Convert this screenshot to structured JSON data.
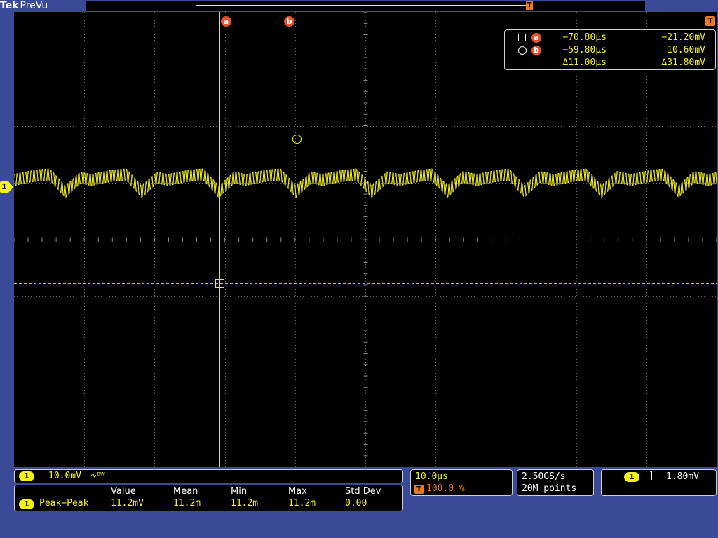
{
  "header": {
    "brand": "Tek",
    "mode": "PreVu",
    "trigger_marker": "T"
  },
  "cursors": {
    "a_label": "a",
    "b_label": "b",
    "trigger_label": "T",
    "a_time": "−70.80µs",
    "a_value": "−21.20mV",
    "b_time": "−59.80µs",
    "b_value": "10.60mV",
    "delta_time": "Δ11.00µs",
    "delta_value": "Δ31.80mV"
  },
  "channel": {
    "number": "1",
    "scale": "10.0mV",
    "bw_symbol": "∿ᴮᵂ"
  },
  "measurement": {
    "headers": {
      "value": "Value",
      "mean": "Mean",
      "min": "Min",
      "max": "Max",
      "std": "Std Dev"
    },
    "channel": "1",
    "name": "Peak−Peak",
    "value": "11.2mV",
    "mean": "11.2m",
    "min": "11.2m",
    "max": "11.2m",
    "std": "0.00"
  },
  "timebase": {
    "scale": "10.0µs",
    "trigger_icon": "T",
    "position": "100.0 %"
  },
  "acquisition": {
    "rate": "2.50GS/s",
    "points": "20M points"
  },
  "trigger": {
    "channel": "1",
    "slope_icon": "falling-edge-icon",
    "slope_glyph": "⌉",
    "level": "1.80mV"
  },
  "colors": {
    "background": "#3a4a96",
    "trace": "#f3f01a",
    "cursor_tag": "#e8502a",
    "trigger_accent": "#e97a1f",
    "grid": "#8a8a8a"
  }
}
